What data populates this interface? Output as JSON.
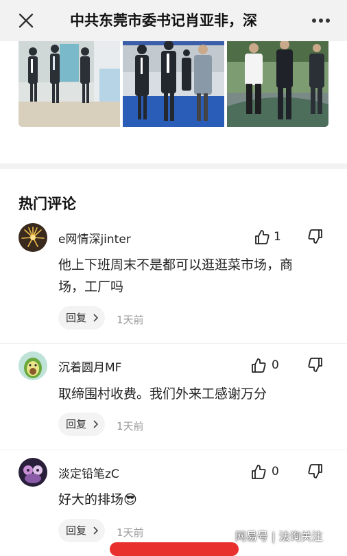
{
  "header": {
    "title": "中共东莞市委书记肖亚非，深",
    "close_icon": "close-icon",
    "more_icon": "more-icon"
  },
  "photos": [
    "photo-1",
    "photo-2",
    "photo-3"
  ],
  "section_title": "热门评论",
  "comments": [
    {
      "username": "e网情深jinter",
      "likes": "1",
      "text_lines": [
        "他上下班周末不是都可以逛逛菜市场，商",
        "场，工厂吗"
      ],
      "reply_label": "回复",
      "time": "1天前"
    },
    {
      "username": "沉着圆月MF",
      "likes": "0",
      "text_lines": [
        "取缔围村收费。我们外来工感谢万分"
      ],
      "reply_label": "回复",
      "time": "1天前"
    },
    {
      "username": "淡定铅笔zC",
      "likes": "0",
      "text_lines": [
        "好大的排场😎"
      ],
      "reply_label": "回复",
      "time": "1天前"
    }
  ],
  "watermark": "网易号 | 法询关注",
  "colors": {
    "accent_red": "#e8312f",
    "reply_bg": "#f3f3f3",
    "time_gray": "#999999",
    "header_bg": "#f2f2f2"
  }
}
